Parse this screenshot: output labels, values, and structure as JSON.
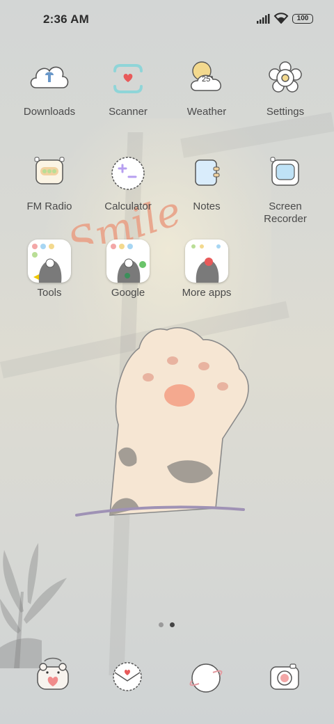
{
  "status_bar": {
    "time": "2:36 AM",
    "battery": "100",
    "signal_icon": "cellular-signal-icon",
    "wifi_icon": "wifi-icon"
  },
  "apps": [
    {
      "label": "Downloads"
    },
    {
      "label": "Scanner"
    },
    {
      "label": "Weather",
      "temp": "25°"
    },
    {
      "label": "Settings"
    },
    {
      "label": "FM Radio"
    },
    {
      "label": "Calculator"
    },
    {
      "label": "Notes"
    },
    {
      "label": "Screen\nRecorder"
    },
    {
      "label": "Tools"
    },
    {
      "label": "Google"
    },
    {
      "label": "More apps"
    }
  ],
  "wallpaper": {
    "text": "Smile"
  },
  "page_indicator": {
    "total": 2,
    "current": 2
  },
  "dock": [
    {
      "icon": "bear-phone-icon"
    },
    {
      "icon": "messages-envelope-icon"
    },
    {
      "icon": "browser-planet-icon"
    },
    {
      "icon": "camera-icon"
    }
  ],
  "colors": {
    "accent_pink": "#f08b8b",
    "label_gray": "#4a4a4a",
    "icon_outline": "#555555"
  }
}
